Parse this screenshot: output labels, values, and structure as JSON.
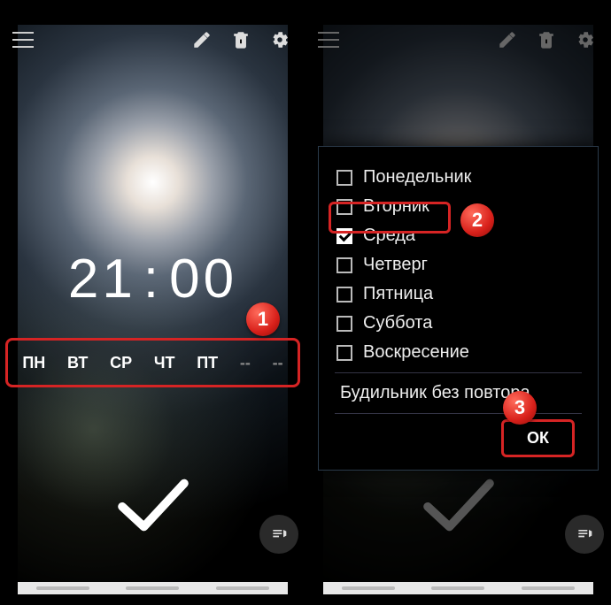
{
  "clock": {
    "hours": "21",
    "minutes": "00"
  },
  "days_bar": [
    "ПН",
    "ВТ",
    "СР",
    "ЧТ",
    "ПТ",
    "--",
    "--"
  ],
  "dialog": {
    "items": [
      {
        "label": "Понедельник",
        "checked": false
      },
      {
        "label": "Вторник",
        "checked": false
      },
      {
        "label": "Среда",
        "checked": true
      },
      {
        "label": "Четверг",
        "checked": false
      },
      {
        "label": "Пятница",
        "checked": false
      },
      {
        "label": "Суббота",
        "checked": false
      },
      {
        "label": "Воскресение",
        "checked": false
      }
    ],
    "no_repeat": "Будильник без повтора",
    "ok": "ОК"
  },
  "markers": {
    "m1": "1",
    "m2": "2",
    "m3": "3"
  }
}
